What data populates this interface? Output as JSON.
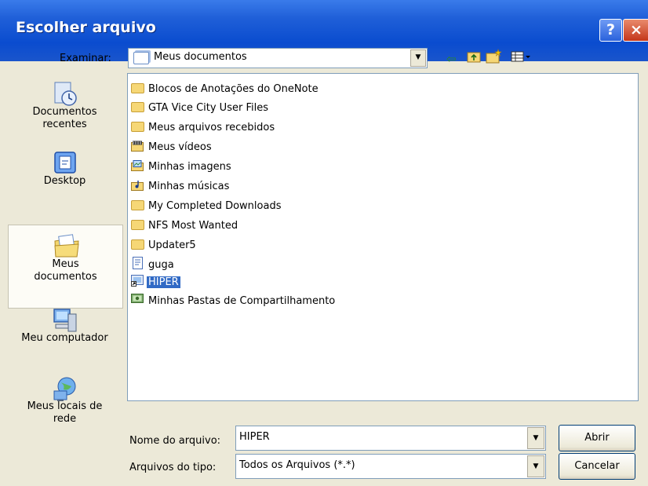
{
  "window": {
    "title": "Escolher arquivo"
  },
  "titlebar": {
    "help_glyph": "?",
    "close_glyph": "×"
  },
  "toolbar": {
    "look_in_label": "Examinar:",
    "look_in_value": "Meus documentos",
    "dropdown_glyph": "▼"
  },
  "places": [
    {
      "label_line1": "Documentos",
      "label_line2": "recentes",
      "icon": "recent-documents-icon"
    },
    {
      "label_line1": "Desktop",
      "label_line2": "",
      "icon": "desktop-icon"
    },
    {
      "label_line1": "Meus",
      "label_line2": "documentos",
      "icon": "my-documents-icon"
    },
    {
      "label_line1": "Meu computador",
      "label_line2": "",
      "icon": "my-computer-icon"
    },
    {
      "label_line1": "Meus locais de",
      "label_line2": "rede",
      "icon": "network-places-icon"
    }
  ],
  "files": [
    {
      "name": "Blocos de Anotações do OneNote",
      "icon": "folder-icon"
    },
    {
      "name": "GTA Vice City User Files",
      "icon": "folder-icon"
    },
    {
      "name": "Meus arquivos recebidos",
      "icon": "folder-icon"
    },
    {
      "name": "Meus vídeos",
      "icon": "videos-folder-icon"
    },
    {
      "name": "Minhas imagens",
      "icon": "pictures-folder-icon"
    },
    {
      "name": "Minhas músicas",
      "icon": "music-folder-icon"
    },
    {
      "name": "My Completed Downloads",
      "icon": "folder-icon"
    },
    {
      "name": "NFS Most Wanted",
      "icon": "folder-icon"
    },
    {
      "name": "Updater5",
      "icon": "folder-icon"
    },
    {
      "name": "guga",
      "icon": "document-icon"
    },
    {
      "name": "HIPER",
      "icon": "shortcut-icon"
    },
    {
      "name": "Minhas Pastas de Compartilhamento",
      "icon": "shared-folder-icon"
    }
  ],
  "selected_file": "HIPER",
  "footer": {
    "filename_label": "Nome do arquivo:",
    "filename_value": "HIPER",
    "filetype_label": "Arquivos do tipo:",
    "filetype_value": "Todos os Arquivos (*.*)",
    "open_button": "Abrir",
    "cancel_button": "Cancelar"
  },
  "colors": {
    "titlebar": "#0a4ccf",
    "selection": "#316ac5",
    "dialog_bg": "#ece9d8",
    "folder": "#f6d776"
  }
}
